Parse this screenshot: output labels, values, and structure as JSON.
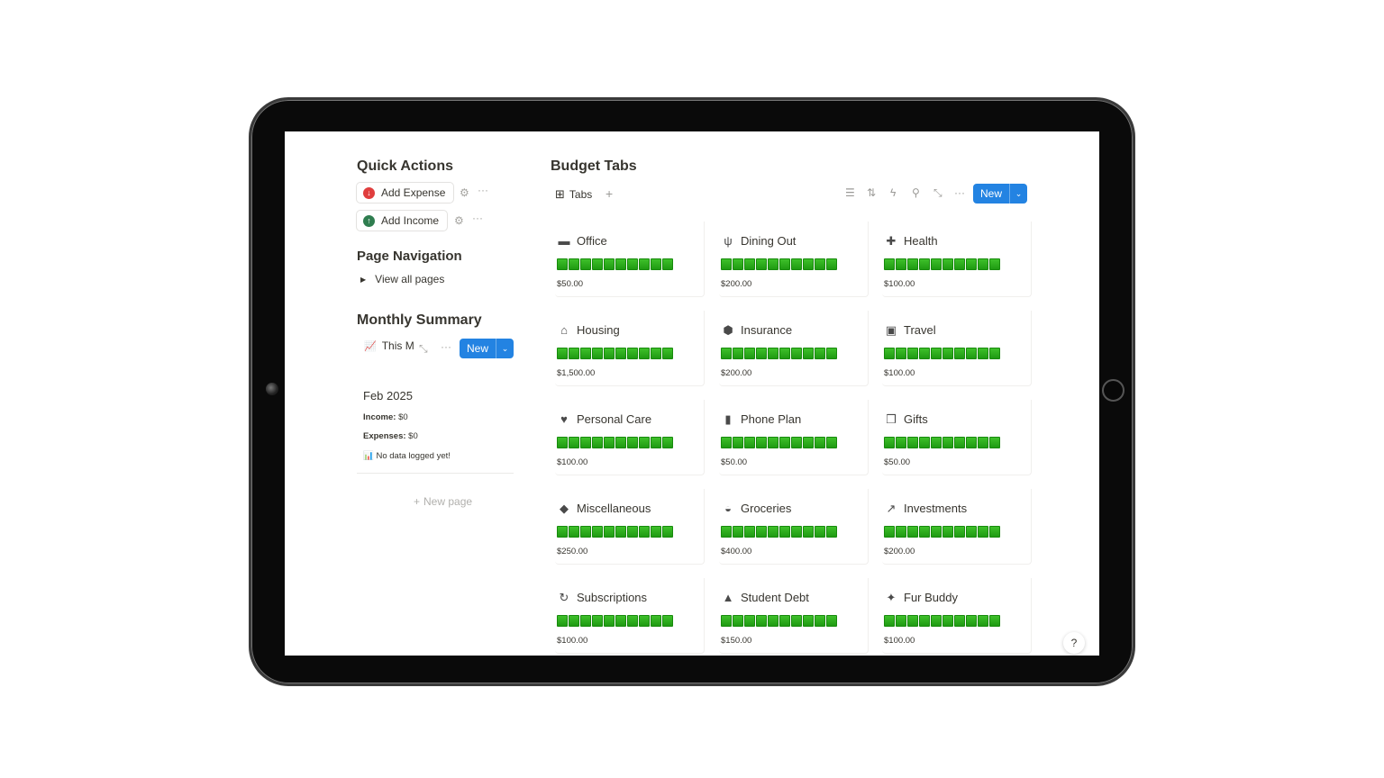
{
  "quick_actions": {
    "title": "Quick Actions",
    "buttons": [
      {
        "label": "Add Expense",
        "icon": "arrow-down-circle-icon",
        "color": "#e03e3e"
      },
      {
        "label": "Add Income",
        "icon": "arrow-up-circle-icon",
        "color": "#2f7d4f"
      }
    ]
  },
  "page_navigation": {
    "title": "Page Navigation",
    "toggle_label": "View all pages"
  },
  "monthly_summary": {
    "title": "Monthly Summary",
    "view_name": "This M",
    "new_label": "New",
    "card": {
      "month": "Feb 2025",
      "income_label": "Income:",
      "income_value": "$0",
      "expenses_label": "Expenses:",
      "expenses_value": "$0",
      "note": "No data logged yet!"
    },
    "new_page_label": "New page"
  },
  "budget_tabs": {
    "title": "Budget Tabs",
    "view_name": "Tabs",
    "new_label": "New",
    "bar_color": "#22a516",
    "cards": [
      {
        "name": "Office",
        "icon": "desktop-icon",
        "amount": "$50.00"
      },
      {
        "name": "Dining Out",
        "icon": "dining-icon",
        "amount": "$200.00"
      },
      {
        "name": "Health",
        "icon": "medical-cross-icon",
        "amount": "$100.00"
      },
      {
        "name": "Housing",
        "icon": "house-icon",
        "amount": "$1,500.00"
      },
      {
        "name": "Insurance",
        "icon": "shield-icon",
        "amount": "$200.00"
      },
      {
        "name": "Travel",
        "icon": "suitcase-icon",
        "amount": "$100.00"
      },
      {
        "name": "Personal Care",
        "icon": "heart-icon",
        "amount": "$100.00"
      },
      {
        "name": "Phone Plan",
        "icon": "phone-icon",
        "amount": "$50.00"
      },
      {
        "name": "Gifts",
        "icon": "gift-icon",
        "amount": "$50.00"
      },
      {
        "name": "Miscellaneous",
        "icon": "bag-icon",
        "amount": "$250.00"
      },
      {
        "name": "Groceries",
        "icon": "basket-icon",
        "amount": "$400.00"
      },
      {
        "name": "Investments",
        "icon": "chart-line-icon",
        "amount": "$200.00"
      },
      {
        "name": "Subscriptions",
        "icon": "refresh-icon",
        "amount": "$100.00"
      },
      {
        "name": "Student Debt",
        "icon": "graduation-cap-icon",
        "amount": "$150.00"
      },
      {
        "name": "Fur Buddy",
        "icon": "dog-icon",
        "amount": "$100.00"
      }
    ]
  }
}
